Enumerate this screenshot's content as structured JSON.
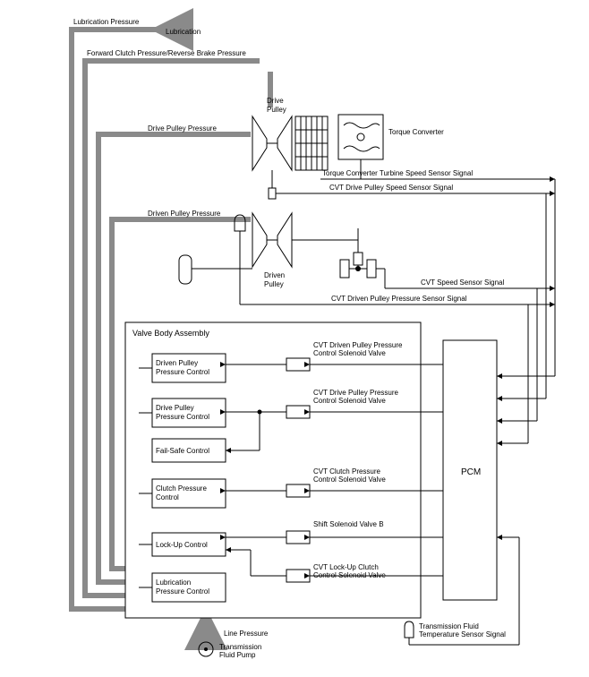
{
  "top_labels": {
    "lubrication_pressure": "Lubrication Pressure",
    "lubrication": "Lubrication",
    "forward_clutch_pressure": "Forward Clutch Pressure/Reverse Brake Pressure",
    "drive_pulley_label": "Drive\nPulley",
    "drive_pulley_pressure": "Drive Pulley Pressure",
    "torque_converter": "Torque Converter",
    "torque_converter_signal": "Torque Converter Turbine Speed Sensor Signal",
    "cvt_drive_pulley_signal": "CVT Drive Pulley Speed Sensor Signal",
    "driven_pulley_pressure": "Driven Pulley Pressure",
    "driven_pulley_label": "Driven\nPulley",
    "cvt_speed_signal": "CVT Speed Sensor Signal",
    "cvt_driven_pulley_pressure_signal": "CVT Driven Pulley Pressure Sensor Signal"
  },
  "valve_body": {
    "title": "Valve Body Assembly",
    "controls": [
      "Driven Pulley\nPressure Control",
      "Drive Pulley\nPressure Control",
      "Fail-Safe Control",
      "Clutch Pressure\nControl",
      "Lock-Up Control",
      "Lubrication\nPressure Control"
    ],
    "solenoids": [
      "CVT Driven Pulley Pressure\nControl Solenoid Valve",
      "CVT Drive Pulley Pressure\nControl Solenoid Valve",
      "CVT Clutch Pressure\nControl Solenoid Valve",
      "Shift Solenoid Valve B",
      "CVT Lock-Up Clutch\nControl Solenoid Valve"
    ]
  },
  "pcm": "PCM",
  "bottom": {
    "line_pressure": "Line Pressure",
    "pump": "Transmission\nFluid Pump",
    "temp_sensor": "Transmission Fluid\nTemperature Sensor Signal"
  }
}
